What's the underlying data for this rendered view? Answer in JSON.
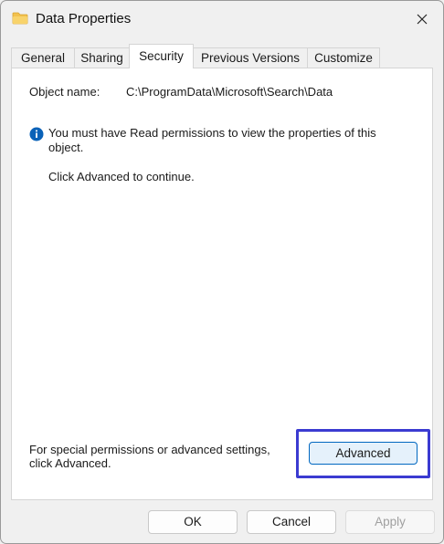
{
  "window": {
    "title": "Data Properties"
  },
  "tabs": [
    {
      "label": "General"
    },
    {
      "label": "Sharing"
    },
    {
      "label": "Security"
    },
    {
      "label": "Previous Versions"
    },
    {
      "label": "Customize"
    }
  ],
  "active_tab": "Security",
  "security": {
    "object_name_label": "Object name:",
    "object_name_value": "C:\\ProgramData\\Microsoft\\Search\\Data",
    "info_message": "You must have Read permissions to view the properties of this object.",
    "continue_message": "Click Advanced to continue.",
    "special_permissions_text": "For special permissions or advanced settings, click Advanced.",
    "advanced_label": "Advanced"
  },
  "footer": {
    "ok_label": "OK",
    "cancel_label": "Cancel",
    "apply_label": "Apply"
  },
  "colors": {
    "accent": "#0067c0",
    "highlight_border": "#3b3bd1",
    "folder": "#f2c14e",
    "info_icon": "#0a62b8"
  },
  "icons": [
    "folder-icon",
    "close-icon",
    "info-icon"
  ]
}
